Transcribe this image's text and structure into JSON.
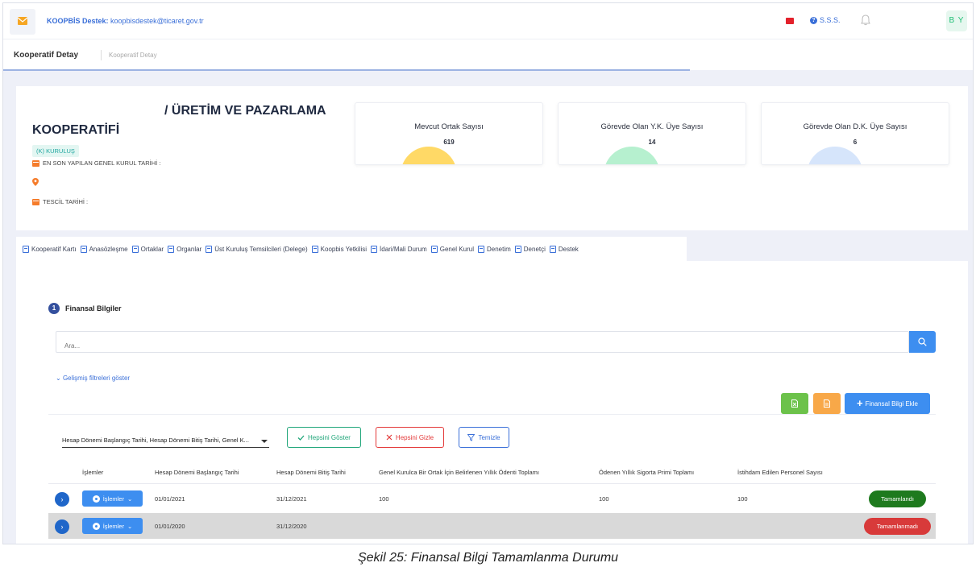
{
  "topbar": {
    "helpdesk_label": "KOOPBİS Destek:",
    "helpdesk_email": "koopbisdestek@ticaret.gov.tr",
    "faq_label": "S.S.S.",
    "avatar_initials": "B Y"
  },
  "subheader": {
    "title": "Kooperatif Detay",
    "breadcrumb": "Kooperatif Detay"
  },
  "cooperative": {
    "name": "KOOPERATİFİ",
    "type_title": "/ ÜRETİM VE PAZARLAMA",
    "badge": "(K) KURULUŞ",
    "last_assembly_label": "EN SON YAPILAN GENEL KURUL TARİHİ :",
    "registration_label": "TESCİL TARİHİ :"
  },
  "stats": [
    {
      "label": "Mevcut Ortak Sayısı",
      "value": "619",
      "color": "#ffd966"
    },
    {
      "label": "Görevde Olan Y.K. Üye Sayısı",
      "value": "14",
      "color": "#b6f0cf"
    },
    {
      "label": "Görevde Olan D.K. Üye Sayısı",
      "value": "6",
      "color": "#d6e5fb"
    }
  ],
  "tabs": [
    "Kooperatif Kartı",
    "Anasözleşme",
    "Ortaklar",
    "Organlar",
    "Üst Kuruluş Temsilcileri (Delege)",
    "Koopbis Yetkilisi",
    "İdari/Mali Durum",
    "Genel Kurul",
    "Denetim",
    "Denetçi",
    "Destek"
  ],
  "section": {
    "step_number": "1",
    "title": "Finansal Bilgiler",
    "search_placeholder": "Ara...",
    "advanced_filters": "Gelişmiş filtreleri göster",
    "add_button": "Finansal Bilgi Ekle",
    "column_select_value": "Hesap Dönemi Başlangıç Tarihi, Hesap Dönemi Bitiş Tarihi, Genel K...",
    "show_all": "Hepsini Göster",
    "hide_all": "Hepsini Gizle",
    "clear": "Temizle"
  },
  "colors": {
    "excel_green": "#6cc24a",
    "pdf_orange": "#f8a848",
    "primary": "#3d8ef0"
  },
  "table": {
    "headers": [
      "İşlemler",
      "Hesap Dönemi Başlangıç Tarihi",
      "Hesap Dönemi Bitiş Tarihi",
      "Genel Kurulca Bir Ortak İçin Belirlenen Yıllık Ödenti Toplamı",
      "Ödenen Yıllık Sigorta Primi Toplamı",
      "İstihdam Edilen Personel Sayısı"
    ],
    "rows": [
      {
        "actions": "İşlemler",
        "start": "01/01/2021",
        "end": "31/12/2021",
        "dues": "100",
        "insurance": "100",
        "personnel": "100",
        "status": "Tamamlandı"
      },
      {
        "actions": "İşlemler",
        "start": "01/01/2020",
        "end": "31/12/2020",
        "dues": "",
        "insurance": "",
        "personnel": "",
        "status": "Tamamlanmadı"
      }
    ]
  },
  "caption": "Şekil 25: Finansal Bilgi Tamamlanma Durumu"
}
